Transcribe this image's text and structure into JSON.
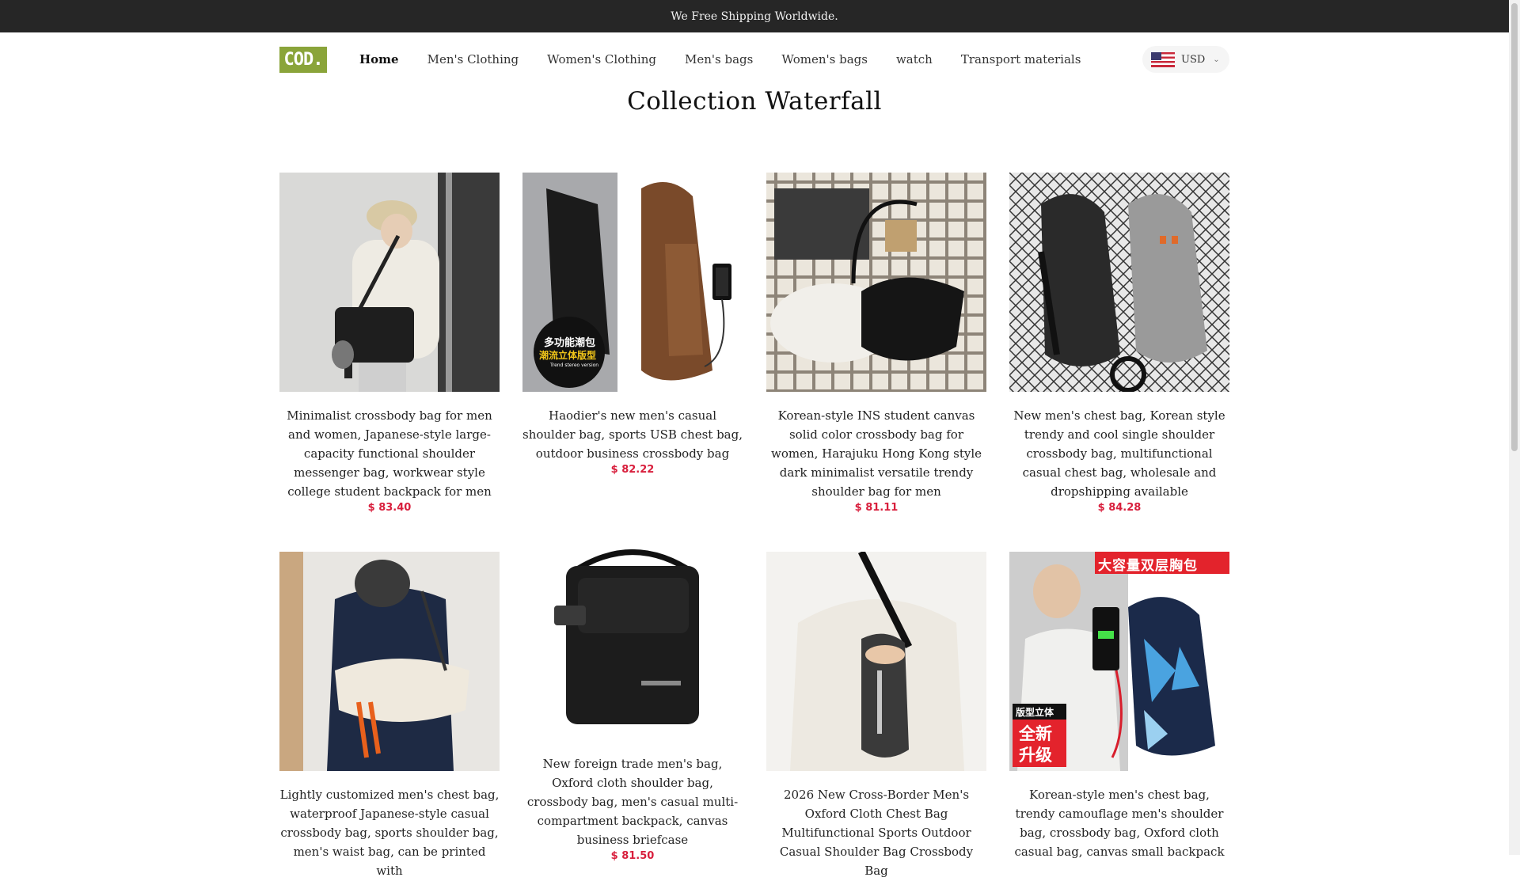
{
  "announcement": "We Free Shipping Worldwide.",
  "logo_text": "COD.",
  "nav": [
    {
      "label": "Home",
      "active": true
    },
    {
      "label": "Men's Clothing",
      "active": false
    },
    {
      "label": "Women's Clothing",
      "active": false
    },
    {
      "label": "Men's bags",
      "active": false
    },
    {
      "label": "Women's bags",
      "active": false
    },
    {
      "label": "watch",
      "active": false
    },
    {
      "label": "Transport materials",
      "active": false
    }
  ],
  "currency": "USD",
  "page_title": "Collection Waterfall",
  "products": [
    {
      "name": "Minimalist crossbody bag for men and women, Japanese-style large-capacity functional shoulder messenger bag, workwear style college student backpack for men",
      "price": "$ 83.40"
    },
    {
      "name": "Haodier's new men's casual shoulder bag, sports USB chest bag, outdoor business crossbody bag",
      "price": "$ 82.22",
      "badge_lines": [
        "多功能潮包",
        "潮流立体版型",
        "Trend stereo version"
      ]
    },
    {
      "name": "Korean-style INS student canvas solid color crossbody bag for women, Harajuku Hong Kong style dark minimalist versatile trendy shoulder bag for men",
      "price": "$ 81.11"
    },
    {
      "name": "New men's chest bag, Korean style trendy and cool single shoulder crossbody bag, multifunctional casual chest bag, wholesale and dropshipping available",
      "price": "$ 84.28"
    },
    {
      "name": "Lightly customized men's chest bag, waterproof Japanese-style casual crossbody bag, sports shoulder bag, men's waist bag, can be printed with",
      "price": ""
    },
    {
      "name": "New foreign trade men's bag, Oxford cloth shoulder bag, crossbody bag, men's casual multi-compartment backpack, canvas business briefcase",
      "price": "$ 81.50"
    },
    {
      "name": "2026 New Cross-Border Men's Oxford Cloth Chest Bag Multifunctional Sports Outdoor Casual Shoulder Bag Crossbody Bag",
      "price": ""
    },
    {
      "name": "Korean-style men's chest bag, trendy camouflage men's shoulder bag, crossbody bag, Oxford cloth casual bag, canvas small backpack",
      "price": "",
      "badge_top": "大容量双层胸包",
      "badge_side": [
        "版型立体",
        "全新",
        "升级"
      ]
    }
  ]
}
